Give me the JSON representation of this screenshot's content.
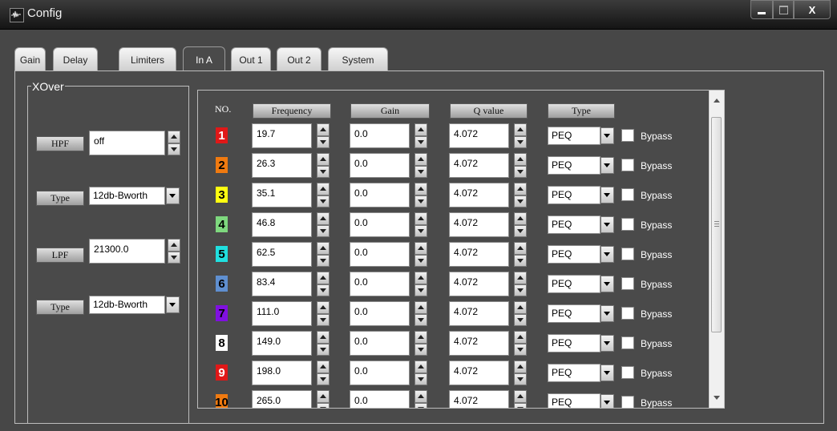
{
  "window": {
    "title": "Config",
    "close_label": "X"
  },
  "tabs": [
    {
      "label": "Gain"
    },
    {
      "label": "Delay"
    },
    {
      "label": "Limiters"
    },
    {
      "label": "In A",
      "active": true
    },
    {
      "label": "Out 1"
    },
    {
      "label": "Out 2"
    },
    {
      "label": "System"
    }
  ],
  "xover": {
    "legend": "XOver",
    "hpf_label": "HPF",
    "hpf_value": "off",
    "type1_label": "Type",
    "type1_value": "12db-Bworth",
    "lpf_label": "LPF",
    "lpf_value": "21300.0",
    "type2_label": "Type",
    "type2_value": "12db-Bworth"
  },
  "peq": {
    "headers": {
      "no": "NO.",
      "frequency": "Frequency",
      "gain": "Gain",
      "q": "Q value",
      "type": "Type"
    },
    "bypass_label": "Bypass",
    "rows": [
      {
        "no": "1",
        "color": "#e01818",
        "text_color": "#ffffff",
        "frequency": "19.7",
        "gain": "0.0",
        "q": "4.072",
        "type": "PEQ"
      },
      {
        "no": "2",
        "color": "#f07a10",
        "text_color": "#000000",
        "frequency": "26.3",
        "gain": "0.0",
        "q": "4.072",
        "type": "PEQ"
      },
      {
        "no": "3",
        "color": "#ffff10",
        "text_color": "#000000",
        "frequency": "35.1",
        "gain": "0.0",
        "q": "4.072",
        "type": "PEQ"
      },
      {
        "no": "4",
        "color": "#7ed87e",
        "text_color": "#000000",
        "frequency": "46.8",
        "gain": "0.0",
        "q": "4.072",
        "type": "PEQ"
      },
      {
        "no": "5",
        "color": "#20e0e0",
        "text_color": "#000000",
        "frequency": "62.5",
        "gain": "0.0",
        "q": "4.072",
        "type": "PEQ"
      },
      {
        "no": "6",
        "color": "#5f8fd0",
        "text_color": "#000000",
        "frequency": "83.4",
        "gain": "0.0",
        "q": "4.072",
        "type": "PEQ"
      },
      {
        "no": "7",
        "color": "#8010e0",
        "text_color": "#000000",
        "frequency": "111.0",
        "gain": "0.0",
        "q": "4.072",
        "type": "PEQ"
      },
      {
        "no": "8",
        "color": "#ffffff",
        "text_color": "#000000",
        "frequency": "149.0",
        "gain": "0.0",
        "q": "4.072",
        "type": "PEQ"
      },
      {
        "no": "9",
        "color": "#e01818",
        "text_color": "#ffffff",
        "frequency": "198.0",
        "gain": "0.0",
        "q": "4.072",
        "type": "PEQ"
      },
      {
        "no": "10",
        "color": "#f07a10",
        "text_color": "#000000",
        "frequency": "265.0",
        "gain": "0.0",
        "q": "4.072",
        "type": "PEQ"
      }
    ]
  }
}
